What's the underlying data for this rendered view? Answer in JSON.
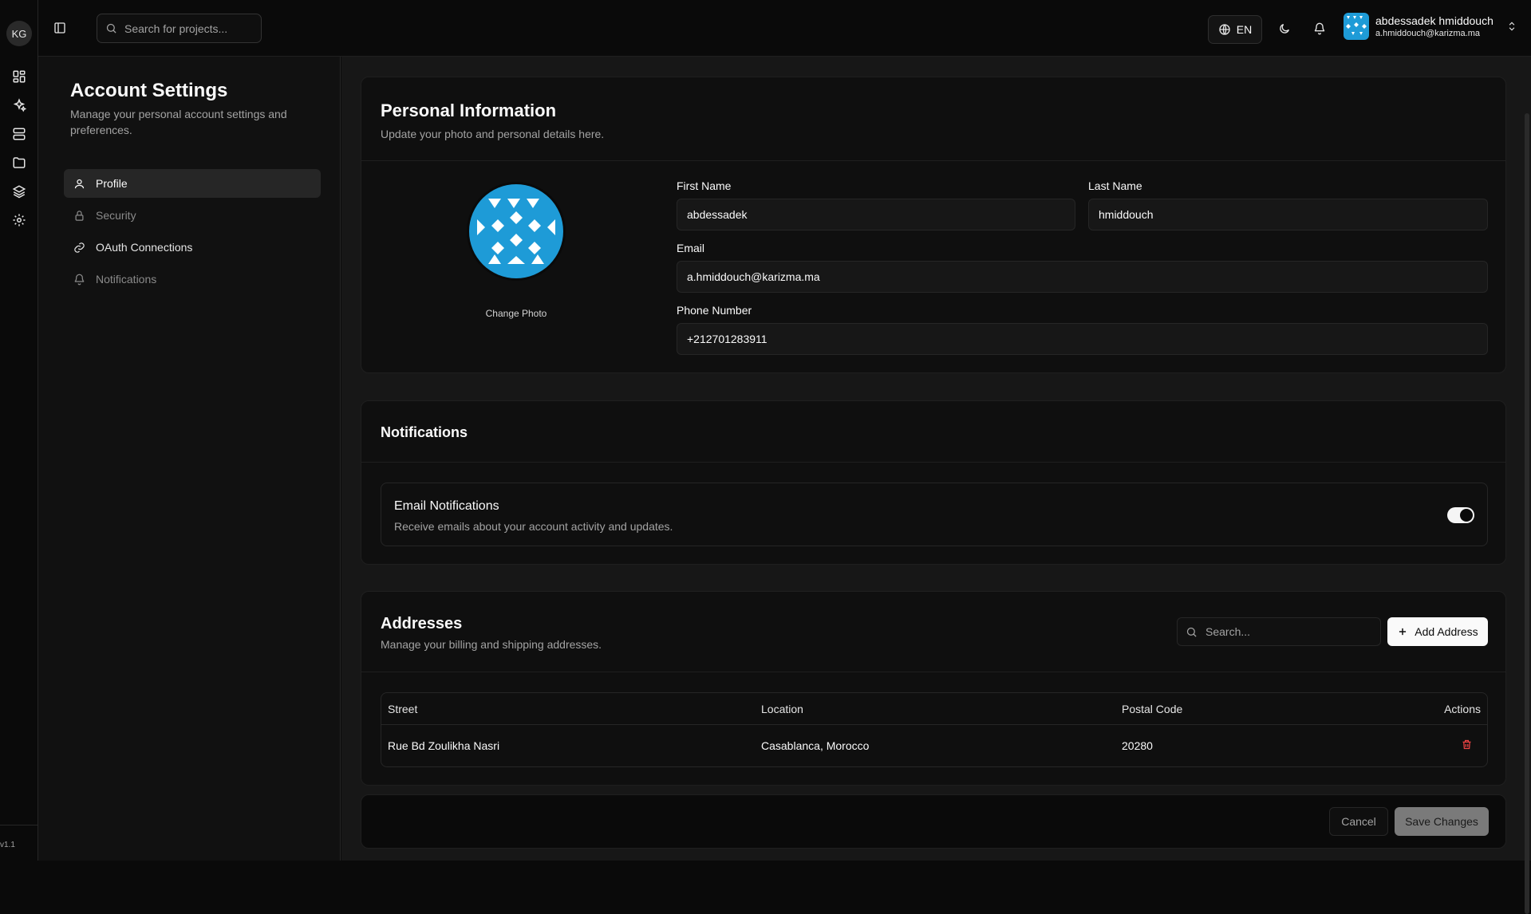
{
  "rail": {
    "logo_text": "KG",
    "version": "v1.1",
    "icons": [
      "dashboard-icon",
      "sparkles-icon",
      "server-icon",
      "folder-icon",
      "layers-icon",
      "gear-icon"
    ]
  },
  "topbar": {
    "search_placeholder": "Search for projects...",
    "language": "EN",
    "user_name": "abdessadek hmiddouch",
    "user_email": "a.hmiddouch@karizma.ma"
  },
  "settings": {
    "title": "Account Settings",
    "subtitle": "Manage your personal account settings and preferences.",
    "nav": [
      {
        "label": "Profile",
        "icon": "user-icon",
        "state": "active"
      },
      {
        "label": "Security",
        "icon": "lock-icon",
        "state": "muted"
      },
      {
        "label": "OAuth Connections",
        "icon": "link-icon",
        "state": "light"
      },
      {
        "label": "Notifications",
        "icon": "bell-icon",
        "state": "muted"
      }
    ]
  },
  "personal": {
    "title": "Personal Information",
    "description": "Update your photo and personal details here.",
    "change_photo": "Change Photo",
    "first_name_label": "First Name",
    "first_name": "abdessadek",
    "last_name_label": "Last Name",
    "last_name": "hmiddouch",
    "email_label": "Email",
    "email": "a.hmiddouch@karizma.ma",
    "phone_label": "Phone Number",
    "phone": "+212701283911"
  },
  "notifications": {
    "title": "Notifications",
    "email_title": "Email Notifications",
    "email_desc": "Receive emails about your account activity and updates.",
    "email_enabled": true
  },
  "addresses": {
    "title": "Addresses",
    "description": "Manage your billing and shipping addresses.",
    "search_placeholder": "Search...",
    "add_label": "Add Address",
    "columns": [
      "Street",
      "Location",
      "Postal Code",
      "Actions"
    ],
    "rows": [
      {
        "street": "Rue Bd Zoulikha Nasri",
        "location": "Casablanca, Morocco",
        "postal": "20280"
      }
    ]
  },
  "footer": {
    "cancel": "Cancel",
    "save": "Save Changes"
  },
  "colors": {
    "background": "#0a0a0a",
    "panel": "#111111",
    "danger": "#ef4444",
    "avatar_blue": "#1e9bd7"
  }
}
